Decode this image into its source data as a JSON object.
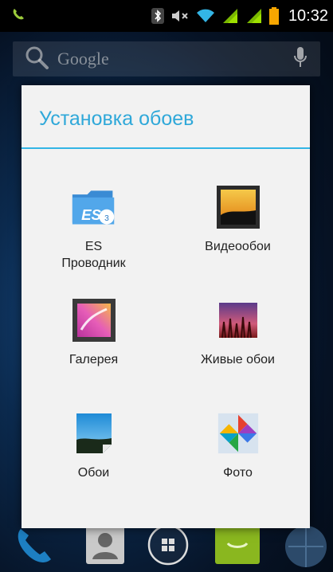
{
  "status_bar": {
    "time": "10:32"
  },
  "search": {
    "placeholder": "Google"
  },
  "dialog": {
    "title": "Установка обоев",
    "items": [
      {
        "label": "ES\nПроводник",
        "icon": "es-file-explorer-icon"
      },
      {
        "label": "Видеообои",
        "icon": "video-wallpaper-icon"
      },
      {
        "label": "Галерея",
        "icon": "gallery-icon"
      },
      {
        "label": "Живые обои",
        "icon": "live-wallpaper-icon"
      },
      {
        "label": "Обои",
        "icon": "wallpapers-icon"
      },
      {
        "label": "Фото",
        "icon": "photos-icon"
      }
    ]
  },
  "colors": {
    "accent": "#33b5e5",
    "title": "#2fa8d9",
    "dialog_bg": "#f2f2f2"
  }
}
